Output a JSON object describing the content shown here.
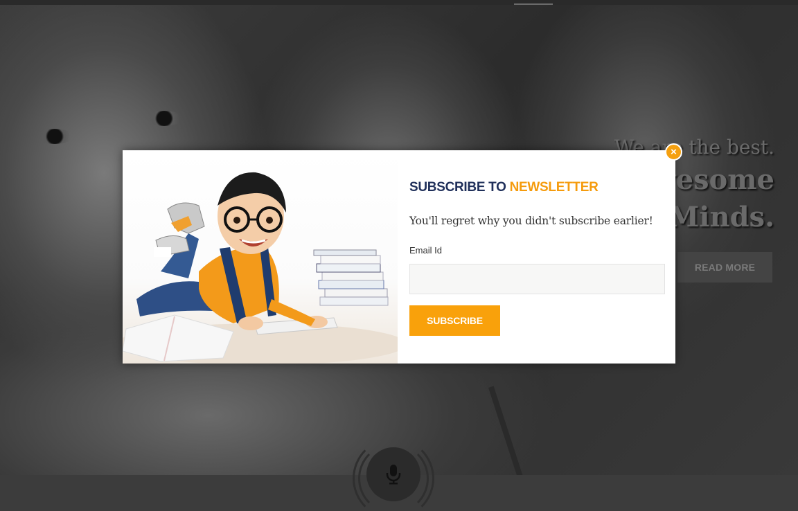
{
  "hero": {
    "tagline": "We are the best.",
    "headline_line1": "Awesome",
    "headline_line2": "Minds.",
    "read_more_label": "READ MORE"
  },
  "modal": {
    "close_symbol": "×",
    "title_part1": "SUBSCRIBE TO ",
    "title_part2": "NEWSLETTER",
    "subtitle": "You'll regret why you didn't subscribe earlier!",
    "email_label": "Email Id",
    "email_value": "",
    "email_placeholder": "",
    "subscribe_label": "SUBSCRIBE"
  },
  "colors": {
    "accent": "#f9a10b",
    "title_dark": "#1f2f5a",
    "title_accent": "#f59b0c",
    "overlay": "#2e2e2e"
  },
  "icons": {
    "close": "close-icon",
    "mic": "microphone-icon"
  }
}
